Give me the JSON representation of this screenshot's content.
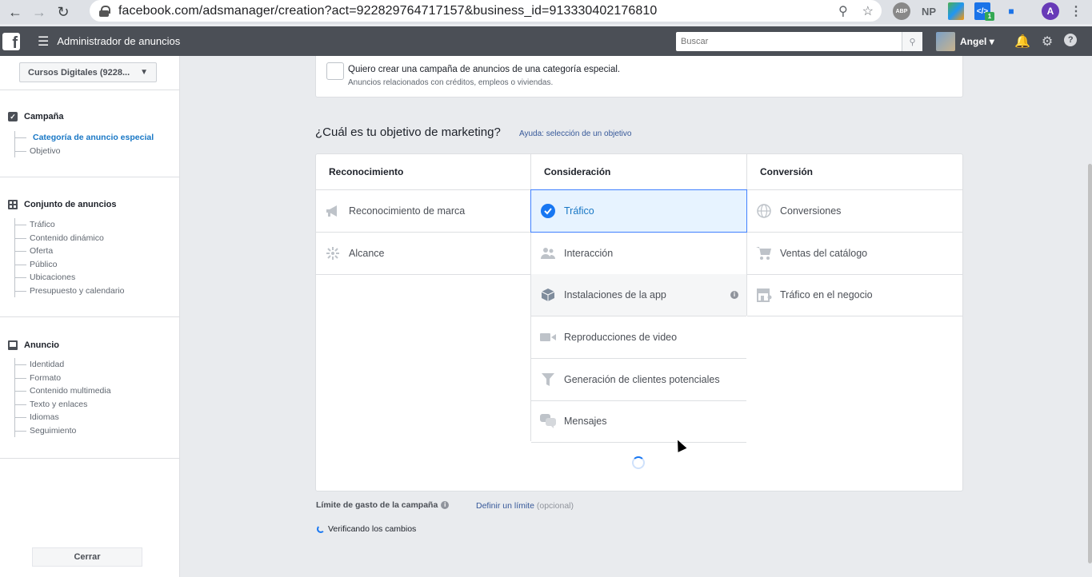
{
  "browser": {
    "url": "facebook.com/adsmanager/creation?act=922829764717157&business_id=913330402176810",
    "extensions": [
      "ABP",
      "NP"
    ],
    "profile_initial": "A",
    "ext_badge": "1"
  },
  "fbbar": {
    "logo": "f",
    "title": "Administrador de anuncios",
    "search_placeholder": "Buscar",
    "user": "Angel"
  },
  "sidebar": {
    "account": "Cursos Digitales (9228...",
    "campaign": {
      "title": "Campaña",
      "items": [
        "Categoría de anuncio especial",
        "Objetivo"
      ]
    },
    "adset": {
      "title": "Conjunto de anuncios",
      "items": [
        "Tráfico",
        "Contenido dinámico",
        "Oferta",
        "Público",
        "Ubicaciones",
        "Presupuesto y calendario"
      ]
    },
    "ad": {
      "title": "Anuncio",
      "items": [
        "Identidad",
        "Formato",
        "Contenido multimedia",
        "Texto y enlaces",
        "Idiomas",
        "Seguimiento"
      ]
    },
    "close": "Cerrar"
  },
  "special": {
    "label": "Quiero crear una campaña de anuncios de una categoría especial.",
    "sub": "Anuncios relacionados con créditos, empleos o viviendas."
  },
  "objective": {
    "heading": "¿Cuál es tu objetivo de marketing?",
    "help": "Ayuda: selección de un objetivo",
    "columns": [
      {
        "title": "Reconocimiento",
        "items": [
          "Reconocimiento de marca",
          "Alcance"
        ]
      },
      {
        "title": "Consideración",
        "items": [
          "Tráfico",
          "Interacción",
          "Instalaciones de la app",
          "Reproducciones de video",
          "Generación de clientes potenciales",
          "Mensajes"
        ]
      },
      {
        "title": "Conversión",
        "items": [
          "Conversiones",
          "Ventas del catálogo",
          "Tráfico en el negocio"
        ]
      }
    ],
    "selected": "Tráfico"
  },
  "limit": {
    "label": "Límite de gasto de la campaña",
    "link": "Definir un límite",
    "optional": "(opcional)"
  },
  "status": "Verificando los cambios"
}
